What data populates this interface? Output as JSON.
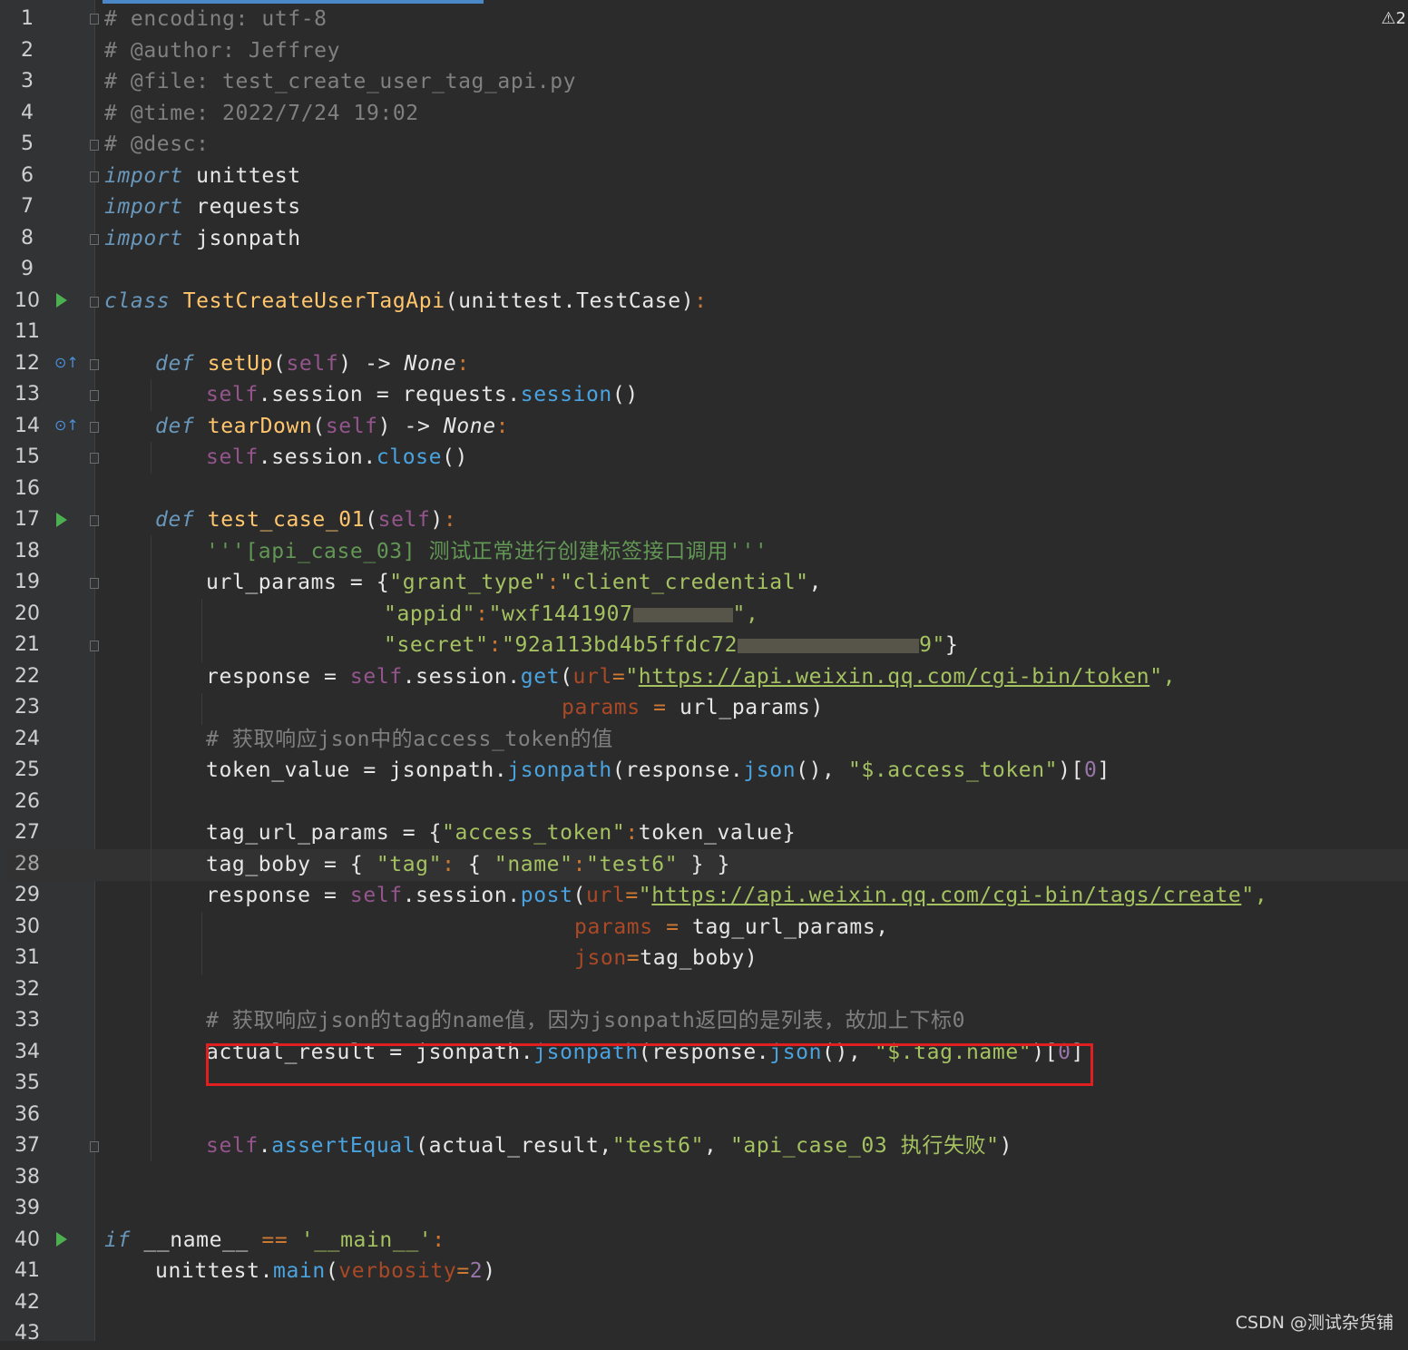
{
  "editor": {
    "warning_count": "2",
    "watermark": "CSDN @测试杂货铺",
    "current_line": 28,
    "line_numbers": [
      "1",
      "2",
      "3",
      "4",
      "5",
      "6",
      "7",
      "8",
      "9",
      "10",
      "11",
      "12",
      "13",
      "14",
      "15",
      "16",
      "17",
      "18",
      "19",
      "20",
      "21",
      "22",
      "23",
      "24",
      "25",
      "26",
      "27",
      "28",
      "29",
      "30",
      "31",
      "32",
      "33",
      "34",
      "35",
      "36",
      "37",
      "38",
      "39",
      "40",
      "41",
      "42",
      "43"
    ]
  },
  "code": {
    "l1": "# encoding: utf-8",
    "l2": "# @author: Jeffrey",
    "l3": "# @file: test_create_user_tag_api.py",
    "l4": "# @time: 2022/7/24 19:02",
    "l5": "# @desc:",
    "import_kw": "import",
    "l6_mod": " unittest",
    "l7_mod": " requests",
    "l8_mod": " jsonpath",
    "class_kw": "class",
    "class_name": " TestCreateUserTagApi",
    "class_base": "(unittest.TestCase)",
    "colon": ":",
    "def_kw": "def",
    "setup_name": " setUp",
    "self": "self",
    "arrow": ") -> ",
    "none": "None",
    "l13_a": ".session = requests.",
    "l13_b": "session",
    "l13_c": "()",
    "teardown_name": " tearDown",
    "l15_a": ".session.",
    "l15_b": "close",
    "l15_c": "()",
    "test_name": " test_case_01",
    "open_paren": "(",
    "close_paren": ")",
    "l18": "'''[api_case_03] 测试正常进行创建标签接口调用'''",
    "l19_a": "url_params = {",
    "l19_b": "\"grant_type\"",
    "l19_c": "\"client_credential\"",
    "l19_d": ",",
    "l20_a": "\"appid\"",
    "l20_b": "\"wxf1441907",
    "l20_c": "\",",
    "l21_a": "\"secret\"",
    "l21_b": "\"92a113bd4b5ffdc72",
    "l21_c": "9\"",
    "l21_d": "}",
    "l22_a": "response = ",
    "l22_b": ".session.",
    "l22_c": "get",
    "l22_d": "url",
    "l22_e": "=",
    "l22_url": "https://api.weixin.qq.com/cgi-bin/token",
    "l22_f": "\",",
    "quote": "\"",
    "l23_a": "params",
    "l23_b": " = ",
    "l23_c": "url_params)",
    "l24": "# 获取响应json中的access_token的值",
    "l25_a": "token_value = jsonpath.",
    "l25_b": "jsonpath",
    "l25_c": "(response.",
    "l25_d": "json",
    "l25_e": "(), ",
    "l25_f": "\"$.access_token\"",
    "l25_g": ")[",
    "zero": "0",
    "l25_h": "]",
    "l27_a": "tag_url_params = {",
    "l27_b": "\"access_token\"",
    "l27_c": "token_value}",
    "l28_a": "tag_boby = { ",
    "l28_b": "\"tag\"",
    "l28_c": " { ",
    "l28_d": "\"name\"",
    "l28_e": "\"test6\"",
    "l28_f": " } }",
    "l29_c": "post",
    "l29_url": "https://api.weixin.qq.com/cgi-bin/tags/create",
    "l30_c": "tag_url_params,",
    "l31_a": "json",
    "l31_c": "tag_boby)",
    "l33": "# 获取响应json的tag的name值，因为jsonpath返回的是列表，故加上下标0",
    "l34_a": "actual_result = jsonpath.",
    "l34_f": "\"$.tag.name\"",
    "l37_a": ".",
    "l37_b": "assertEqual",
    "l37_c": "(actual_result,",
    "l37_d": "\"test6\"",
    "l37_e": ", ",
    "l37_f": "\"api_case_03 执行失败\"",
    "l37_g": ")",
    "if_kw": "if",
    "l40_a": " __name__ ",
    "l40_b": "==",
    "l40_c": " '__main__'",
    "l41_a": "unittest.",
    "l41_b": "main",
    "l41_c": "verbosity",
    "l41_d": "2"
  }
}
